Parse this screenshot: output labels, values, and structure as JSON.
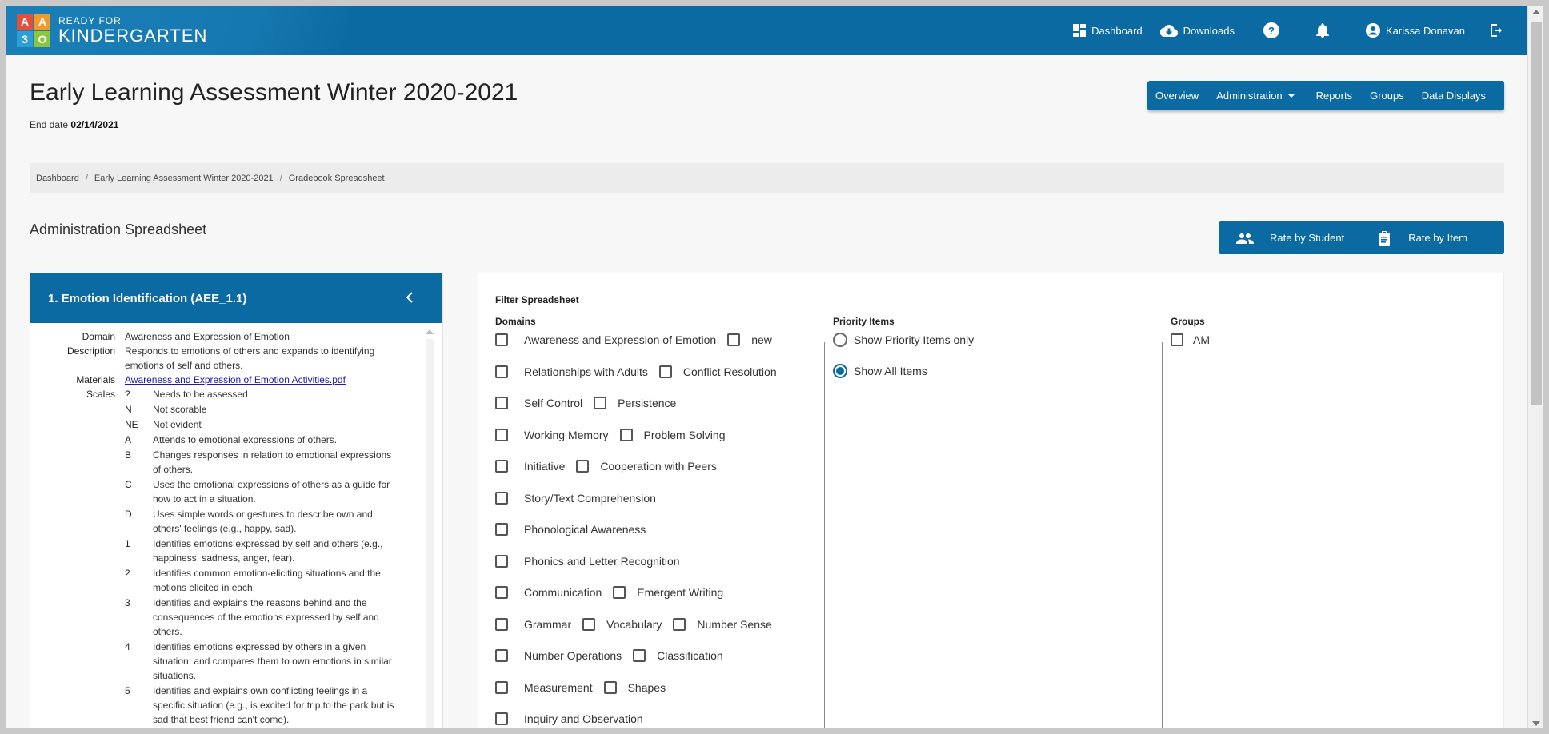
{
  "logo": {
    "blocks": [
      "A",
      "A",
      "3",
      "O"
    ],
    "small": "READY FOR",
    "big": "KINDERGARTEN"
  },
  "topnav": {
    "dashboard": "Dashboard",
    "downloads": "Downloads",
    "user": "Karissa Donavan"
  },
  "page": {
    "title": "Early Learning Assessment Winter 2020-2021",
    "end_date_label": "End date",
    "end_date": "02/14/2021"
  },
  "tabs": {
    "overview": "Overview",
    "administration": "Administration",
    "reports": "Reports",
    "groups": "Groups",
    "data_displays": "Data Displays"
  },
  "breadcrumb": [
    "Dashboard",
    "Early Learning Assessment Winter 2020-2021",
    "Gradebook Spreadsheet"
  ],
  "section": {
    "title": "Administration Spreadsheet",
    "rate_by_student": "Rate by Student",
    "rate_by_item": "Rate by Item"
  },
  "item": {
    "header": "1. Emotion Identification (AEE_1.1)",
    "domain_label": "Domain",
    "domain": "Awareness and Expression of Emotion",
    "description_label": "Description",
    "description": "Responds to emotions of others and expands to identifying emotions of self and others.",
    "materials_label": "Materials",
    "materials": "Awareness and Expression of Emotion Activities.pdf",
    "scales_label": "Scales",
    "scales": [
      {
        "code": "?",
        "desc": "Needs to be assessed"
      },
      {
        "code": "N",
        "desc": "Not scorable"
      },
      {
        "code": "NE",
        "desc": "Not evident"
      },
      {
        "code": "A",
        "desc": "Attends to emotional expressions of others."
      },
      {
        "code": "B",
        "desc": "Changes responses in relation to emotional expressions of others."
      },
      {
        "code": "C",
        "desc": "Uses the emotional expressions of others as a guide for how to act in a situation."
      },
      {
        "code": "D",
        "desc": "Uses simple words or gestures to describe own and others' feelings (e.g., happy, sad)."
      },
      {
        "code": "1",
        "desc": "Identifies emotions expressed by self and others (e.g., happiness, sadness, anger, fear)."
      },
      {
        "code": "2",
        "desc": "Identifies common emotion-eliciting situations and the motions elicited in each."
      },
      {
        "code": "3",
        "desc": "Identifies and explains the reasons behind and the consequences of the emotions expressed by self and others."
      },
      {
        "code": "4",
        "desc": "Identifies emotions expressed by others in a given situation, and compares them to own emotions in similar situations."
      },
      {
        "code": "5",
        "desc": "Identifies and explains own conflicting feelings in a specific situation (e.g., is excited for trip to the park but is sad that best friend can't come)."
      }
    ]
  },
  "filter": {
    "title": "Filter Spreadsheet",
    "domains_label": "Domains",
    "domains": [
      [
        "Awareness and Expression of Emotion",
        "new"
      ],
      [
        "Relationships with Adults",
        "Conflict Resolution"
      ],
      [
        "Self Control",
        "Persistence"
      ],
      [
        "Working Memory",
        "Problem Solving"
      ],
      [
        "Initiative",
        "Cooperation with Peers"
      ],
      [
        "Story/Text Comprehension"
      ],
      [
        "Phonological Awareness"
      ],
      [
        "Phonics and Letter Recognition"
      ],
      [
        "Communication",
        "Emergent Writing"
      ],
      [
        "Grammar",
        "Vocabulary",
        "Number Sense"
      ],
      [
        "Number Operations",
        "Classification"
      ],
      [
        "Measurement",
        "Shapes"
      ],
      [
        "Inquiry and Observation"
      ]
    ],
    "priority_label": "Priority Items",
    "priority_only": "Show Priority Items only",
    "show_all": "Show All Items",
    "groups_label": "Groups",
    "groups": [
      "AM"
    ]
  }
}
